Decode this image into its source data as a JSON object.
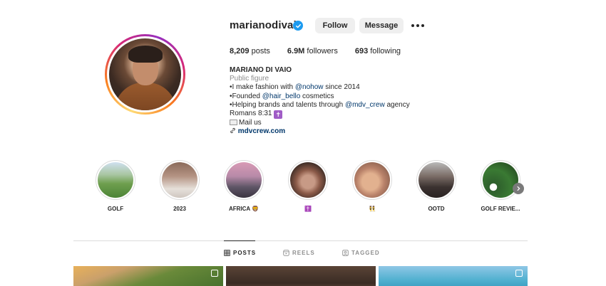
{
  "profile": {
    "username": "marianodivaio",
    "follow_label": "Follow",
    "message_label": "Message",
    "stats": {
      "posts_value": "8,209",
      "posts_label": "posts",
      "followers_value": "6.9M",
      "followers_label": "followers",
      "following_value": "693",
      "following_label": "following"
    },
    "bio": {
      "name": "MARIANO DI VAIO",
      "category": "Public figure",
      "line1_pre": "•I make fashion with ",
      "line1_link": "@nohow",
      "line1_post": " since 2014",
      "line2_pre": "•Founded ",
      "line2_link": "@hair_bello",
      "line2_post": " cosmetics",
      "line3_pre": "•Helping brands and talents through ",
      "line3_link": "@mdv_crew",
      "line3_post": " agency",
      "line4": "Romans 8:31",
      "line4_badge": "✝",
      "line5": "Mail us",
      "url": "mdvcrew.com"
    }
  },
  "highlights": [
    {
      "label": "GOLF"
    },
    {
      "label": "2023"
    },
    {
      "label": "AFRICA 🦁"
    },
    {
      "label": "✝️"
    },
    {
      "label": "👯"
    },
    {
      "label": "OOTD"
    },
    {
      "label": "GOLF REVIE..."
    }
  ],
  "tabs": {
    "posts": "POSTS",
    "reels": "REELS",
    "tagged": "TAGGED"
  },
  "colors": {
    "verified": "#1d9bf0",
    "link": "#00376b",
    "muted": "#8e8e8e",
    "button_bg": "#efefef"
  },
  "icons": [
    "verified-badge-icon",
    "more-options-icon",
    "link-icon",
    "envelope-icon",
    "chevron-right-icon",
    "grid-icon",
    "reels-icon",
    "tagged-icon"
  ]
}
